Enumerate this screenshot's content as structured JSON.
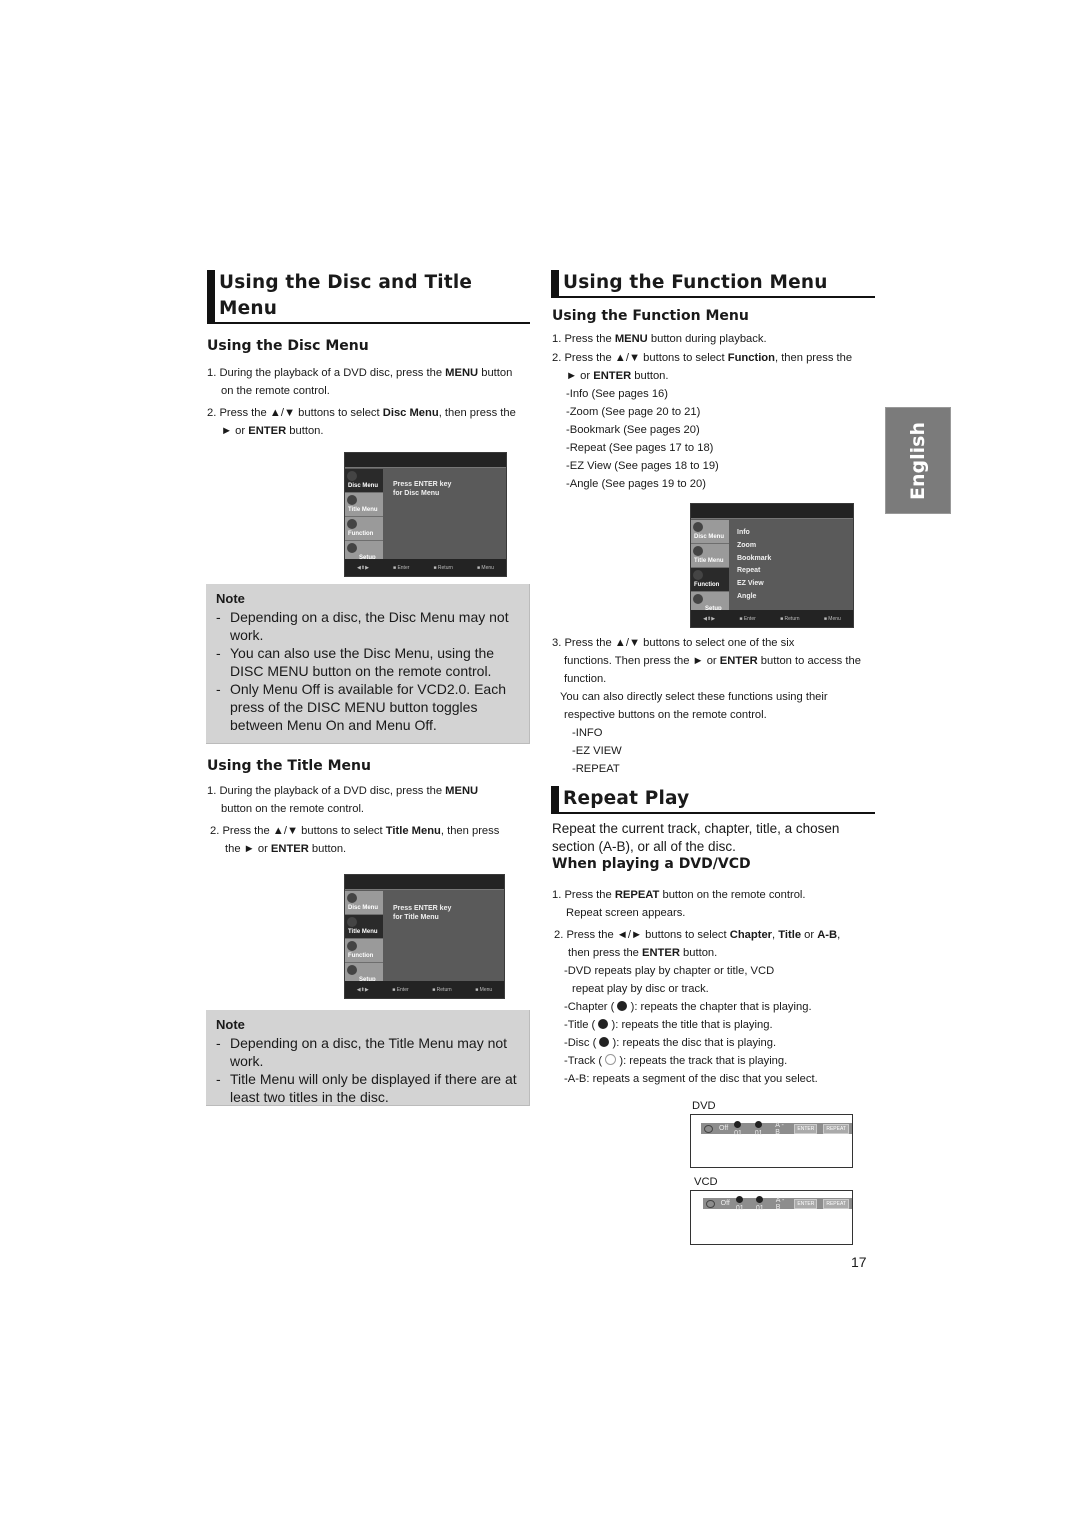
{
  "left": {
    "section_title_line1": "Using the Disc and Title",
    "section_title_line2": "Menu",
    "disc_menu": {
      "heading": "Using the Disc Menu",
      "step1_a": "1. During the playback of a DVD disc, press the ",
      "step1_bold": "MENU",
      "step1_b": " button",
      "step1_c": "on the remote control.",
      "step2_a": "2. Press the ▲/▼ buttons to select ",
      "step2_bold": "Disc Menu",
      "step2_b": ", then press the",
      "step2_c": "► or ",
      "step2_bold2": "ENTER",
      "step2_d": " button.",
      "screen": {
        "sidebar": [
          "Disc Menu",
          "Title Menu",
          "Function",
          "Setup"
        ],
        "selected": "Disc Menu",
        "message_line1": "Press ENTER key",
        "message_line2": "for Disc Menu",
        "footer": [
          "◀⬍▶",
          "■ Enter",
          "■ Return",
          "■ Menu"
        ]
      },
      "note": {
        "title": "Note",
        "items": [
          "Depending on a disc, the Disc Menu may not work.",
          "You can also use the Disc Menu, using the DISC MENU button on the remote control.",
          "Only Menu Off is available for VCD2.0. Each press of the DISC MENU button toggles between Menu On and Menu Off."
        ]
      }
    },
    "title_menu": {
      "heading": "Using the Title Menu",
      "step1_a": "1. During the playback of a DVD disc, press the ",
      "step1_bold": "MENU",
      "step1_c": "button on the remote control.",
      "step2_a": "2. Press the ▲/▼ buttons to select ",
      "step2_bold": "Title Menu",
      "step2_b": ", then press",
      "step2_c": "the ► or ",
      "step2_bold2": "ENTER",
      "step2_d": " button.",
      "screen": {
        "sidebar": [
          "Disc Menu",
          "Title Menu",
          "Function",
          "Setup"
        ],
        "selected": "Title Menu",
        "message_line1": "Press ENTER key",
        "message_line2": "for Title Menu",
        "footer": [
          "◀⬍▶",
          "■ Enter",
          "■ Return",
          "■ Menu"
        ]
      },
      "note": {
        "title": "Note",
        "items": [
          "Depending on a disc, the Title Menu may not work.",
          "Title Menu will only be displayed if there are at least two titles in the disc."
        ]
      }
    }
  },
  "right": {
    "section_title": "Using the Function Menu",
    "function_menu": {
      "heading": "Using the Function Menu",
      "step1_a": "1. Press the ",
      "step1_bold": "MENU",
      "step1_b": " button during playback.",
      "step2_a": "2. Press the ▲/▼ buttons to select ",
      "step2_bold": "Function",
      "step2_b": ", then press the",
      "step2_c": "► or ",
      "step2_bold2": "ENTER",
      "step2_d": " button.",
      "functions": [
        "-Info (See pages 16)",
        "-Zoom (See page 20 to 21)",
        "-Bookmark (See pages 20)",
        "-Repeat (See pages 17 to 18)",
        "-EZ View (See pages 18 to 19)",
        "-Angle (See pages 19 to 20)"
      ],
      "screen": {
        "sidebar": [
          "Disc Menu",
          "Title Menu",
          "Function",
          "Setup"
        ],
        "selected": "Function",
        "items": [
          "Info",
          "Zoom",
          "Bookmark",
          "Repeat",
          "EZ View",
          "Angle"
        ],
        "footer": [
          "◀⬍▶",
          "■ Enter",
          "■ Return",
          "■ Menu"
        ]
      },
      "step3_a": "3. Press the ▲/▼ buttons to select one of the six",
      "step3_b": "functions. Then press the ► or ",
      "step3_bold": "ENTER",
      "step3_c": " button to access the",
      "step3_d": "function.",
      "direct_1": "You can also directly select these functions using their",
      "direct_2": "respective buttons on the remote control.",
      "direct_buttons": [
        "-INFO",
        "-EZ VIEW",
        "-REPEAT"
      ]
    },
    "repeat": {
      "section_title": "Repeat Play",
      "intro_1": "Repeat the current track, chapter, title, a chosen",
      "intro_2": "section (A-B), or all of the disc.",
      "subheading": "When playing a DVD/VCD",
      "step1_a": "1. Press the ",
      "step1_bold": "REPEAT",
      "step1_b": " button on the remote control.",
      "step1_c": "Repeat screen appears.",
      "step2_a": "2. Press the ◄/► buttons to select ",
      "step2_bold1": "Chapter",
      "step2_sep1": ", ",
      "step2_bold2": "Title",
      "step2_sep2": " or ",
      "step2_bold3": "A-B",
      "step2_sep3": ",",
      "step2_c": "then press the ",
      "step2_bold4": "ENTER",
      "step2_d": " button.",
      "detail_1": "-DVD repeats play by chapter or title, VCD",
      "detail_2": "repeat play by disc or track.",
      "chapter_a": "-Chapter (",
      "chapter_b": "): repeats the chapter that is playing.",
      "title_a": "-Title (",
      "title_b": "): repeats the title that is playing.",
      "disc_a": "-Disc (",
      "disc_b": "): repeats the disc that is playing.",
      "track_a": "-Track (",
      "track_b": "): repeats the track that is playing.",
      "ab": "-A-B: repeats a segment of the disc that you select.",
      "dvd_label": "DVD",
      "vcd_label": "VCD",
      "bar": {
        "off": "Off",
        "chapter": "01",
        "title": "01",
        "ab": "A - B",
        "enter": "ENTER",
        "repeat": "REPEAT"
      }
    }
  },
  "side_tab": "English",
  "page_number": "17"
}
